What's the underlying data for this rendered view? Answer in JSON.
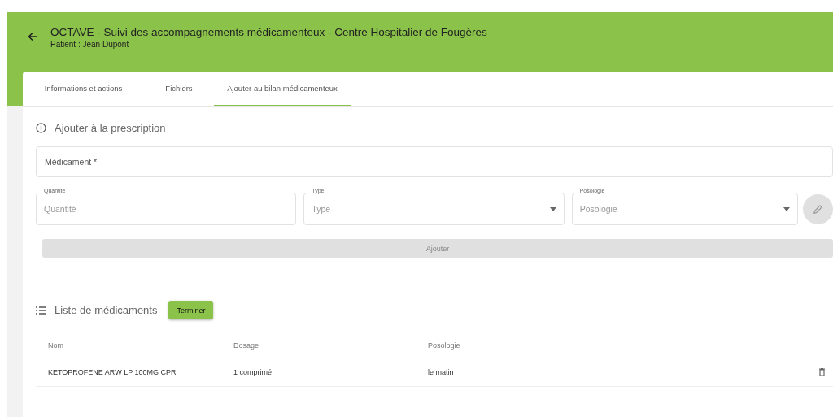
{
  "header": {
    "title": "OCTAVE - Suivi des accompagnements médicamenteux - Centre Hospitalier de Fougères",
    "subtitle": "Patient : Jean Dupont"
  },
  "tabs": [
    {
      "label": "Informations et actions",
      "selected": false
    },
    {
      "label": "Fichiers",
      "selected": false
    },
    {
      "label": "Ajouter au bilan médicamenteux",
      "selected": true
    }
  ],
  "prescription": {
    "title": "Ajouter à la prescription",
    "medicament": {
      "placeholder": "Médicament *"
    },
    "fields": [
      {
        "kind": "input",
        "label": "Quantité",
        "placeholder": "Quantité"
      },
      {
        "kind": "select",
        "label": "Type",
        "placeholder": "Type"
      },
      {
        "kind": "select",
        "label": "Posologie",
        "placeholder": "Posologie"
      }
    ],
    "submit": {
      "label": "Ajouter",
      "disabled": true
    }
  },
  "list": {
    "title": "Liste de médicaments",
    "button": "Terminer",
    "columns": [
      "Nom",
      "Dosage",
      "Posologie"
    ],
    "rows": [
      {
        "cells": [
          "KETOPROFENE ARW LP 100MG CPR",
          "1 comprimé",
          "le matin"
        ]
      }
    ]
  }
}
